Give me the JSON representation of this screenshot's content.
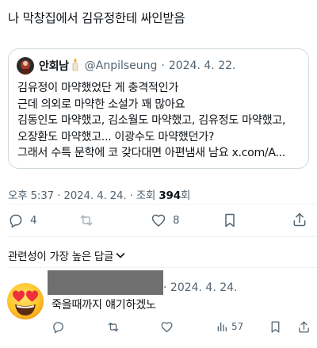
{
  "post": {
    "text": "나 막창집에서 김유정한테 싸인받음"
  },
  "quote": {
    "name": "안회남",
    "handle": "@Anpilseung",
    "separator": "·",
    "date": "2024. 4. 22.",
    "lines": [
      "김유정이 마약했었단 게 충격적인가",
      "근데 의외로 마약한 소설가 꽤 많아요",
      "김동인도 마약했고, 김소월도 마약했고, 김유정도 마약했고,",
      "오장환도 마약했고... 이광수도 마약했던가?",
      "그래서 수특 문학에 코 갖다대면 아편냄새 남요 x.com/A..."
    ]
  },
  "meta": {
    "time": "오후 5:37",
    "sep1": "·",
    "date": "2024. 4. 24.",
    "sep2": "·",
    "views_label": "조회",
    "views": "394",
    "views_suffix": "회"
  },
  "actions": {
    "replies": "4",
    "retweets": "",
    "likes": "8"
  },
  "sort": {
    "label": "관련성이 가장 높은 답글"
  },
  "reply": {
    "date_prefix": "·",
    "date": "2024. 4. 24.",
    "text": "죽을때까지 얘기하겠노",
    "views": "57"
  },
  "colors": {
    "text": "#0f1419",
    "secondary": "#536471",
    "border": "#cfd9de",
    "redaction": "#6f6f6f"
  },
  "icons": [
    "reply-icon",
    "retweet-icon",
    "like-icon",
    "bookmark-icon",
    "share-icon",
    "views-icon",
    "chevron-down-icon",
    "candle-icon",
    "heart-eyes-emoji"
  ]
}
